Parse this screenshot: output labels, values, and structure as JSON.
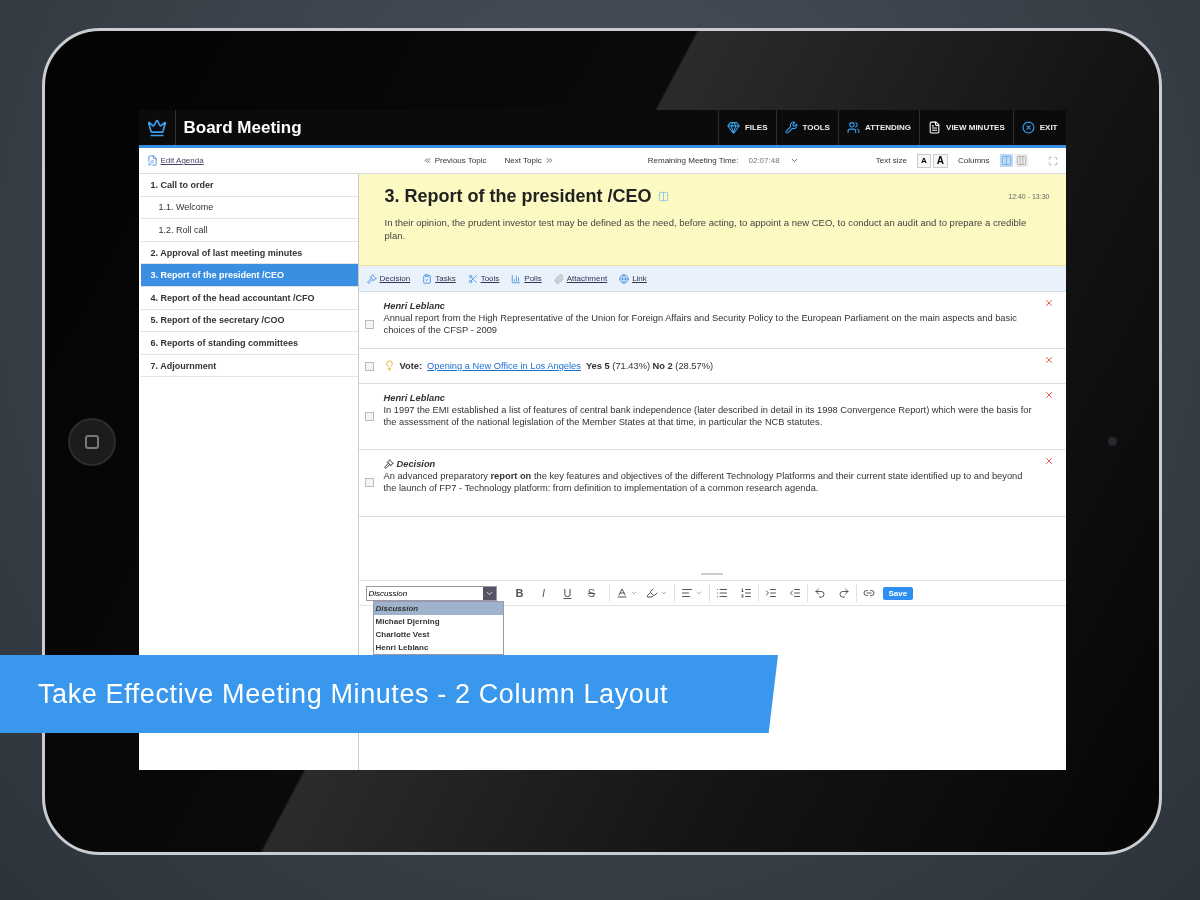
{
  "app": {
    "title": "Board Meeting"
  },
  "top_menu": [
    {
      "kind": "files",
      "label": "FILES"
    },
    {
      "kind": "tools",
      "label": "TOOLS"
    },
    {
      "kind": "attending",
      "label": "ATTENDING"
    },
    {
      "kind": "minutes",
      "label": "VIEW MINUTES"
    },
    {
      "kind": "exit",
      "label": "EXIT"
    }
  ],
  "toolbar": {
    "edit_agenda": "Edit Agenda",
    "previous_topic": "Previous Topic",
    "next_topic": "Next Topic",
    "remaining_label": "Remaining Meeting Time:",
    "remaining_time": "02:07:48",
    "text_size_label": "Text size",
    "text_sizes": [
      "A",
      "A"
    ],
    "columns_label": "Columns",
    "column_layouts": [
      {
        "selected": true
      },
      {
        "selected": false
      }
    ]
  },
  "agenda": [
    {
      "label": "1. Call to order",
      "selected": false,
      "children": [
        {
          "label": "1.1. Welcome",
          "selected": false
        },
        {
          "label": "1.2. Roll call",
          "selected": false
        }
      ]
    },
    {
      "label": "2. Approval of last meeting minutes",
      "selected": false
    },
    {
      "label": "3. Report of the president /CEO",
      "selected": true
    },
    {
      "label": "4. Report of the head accountant /CFO",
      "selected": false
    },
    {
      "label": "5. Report of the secretary /COO",
      "selected": false
    },
    {
      "label": "6. Reports of standing committees",
      "selected": false
    },
    {
      "label": "7. Adjournment",
      "selected": false
    }
  ],
  "topic": {
    "title": "3. Report of the president /CEO",
    "time": "12:40 - 13:30",
    "description": "In their opinion, the prudent investor test may be defined as the need, before acting, to appoint a new CEO, to conduct an audit and to prepare a credible plan."
  },
  "actions": [
    {
      "kind": "decision",
      "label": "Decision"
    },
    {
      "kind": "tasks",
      "label": "Tasks"
    },
    {
      "kind": "tools",
      "label": "Tools"
    },
    {
      "kind": "polls",
      "label": "Polls"
    },
    {
      "kind": "attachment",
      "label": "Attachment"
    },
    {
      "kind": "link",
      "label": "Link"
    }
  ],
  "entries": [
    {
      "kind": "note",
      "checked": false,
      "author": "Henri Leblanc",
      "text": "Annual report from the High Representative of the Union for Foreign Affairs and Security Policy to the European Parliament on the main aspects and basic choices of the CFSP - 2009"
    },
    {
      "kind": "vote",
      "checked": false,
      "label": "Vote:",
      "link": "Opening a New Office in Los Angeles",
      "result": "**Yes 5** (71.43%) **No 2** (28.57%)"
    },
    {
      "kind": "note",
      "checked": false,
      "author": "Henri Leblanc",
      "text": "In 1997 the EMI established a list of features of central bank independence (later described in detail in its 1998 Convergence Report) which were the basis for the assessment of the national legislation of the Member States at that time, in particular the NCB statutes."
    },
    {
      "kind": "decision",
      "checked": false,
      "author": "Decision",
      "text": "An advanced preparatory **report on** the key features and objectives of the different Technology Platforms and their current state identified up to and beyond the launch of FP7 - Technology platform: from definition to implementation of a common research agenda."
    }
  ],
  "editor": {
    "type_select": "Discussion",
    "type_options": [
      {
        "label": "Discussion",
        "selected": true
      },
      {
        "label": "Michael Djerning",
        "selected": false
      },
      {
        "label": "Charlotte Vest",
        "selected": false
      },
      {
        "label": "Henri Leblanc",
        "selected": false
      }
    ],
    "format_buttons": [
      "B",
      "I",
      "U",
      "S"
    ],
    "save": "Save"
  },
  "banner": {
    "text": "Take Effective Meeting Minutes - 2 Column Layout"
  }
}
